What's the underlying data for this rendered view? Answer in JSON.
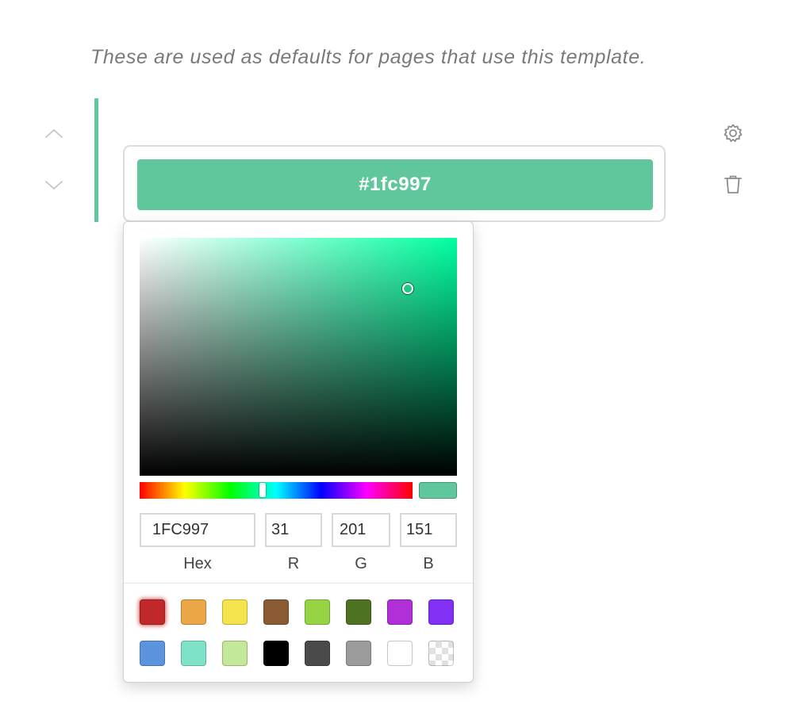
{
  "description_text": "These are used as defaults for pages that use this template.",
  "colors": {
    "accent": "#5fc79b",
    "selected_color": "#1fc997",
    "hue_color": "#00ffa0"
  },
  "color_field": {
    "value_label": "#1fc997"
  },
  "picker": {
    "saturation": 0.845,
    "brightness": 0.788,
    "hue_degrees": 162,
    "fields": {
      "hex": {
        "value": "1FC997",
        "label": "Hex"
      },
      "r": {
        "value": "31",
        "label": "R"
      },
      "g": {
        "value": "201",
        "label": "G"
      },
      "b": {
        "value": "151",
        "label": "B"
      }
    },
    "presets": [
      {
        "name": "red",
        "color": "#c0282a",
        "selected": true
      },
      {
        "name": "orange",
        "color": "#eba646"
      },
      {
        "name": "yellow",
        "color": "#f5e34d"
      },
      {
        "name": "brown",
        "color": "#8a5a33"
      },
      {
        "name": "lime",
        "color": "#97d444"
      },
      {
        "name": "dark-green",
        "color": "#4c7222"
      },
      {
        "name": "purple",
        "color": "#b02fd6"
      },
      {
        "name": "violet",
        "color": "#8230f3"
      },
      {
        "name": "blue",
        "color": "#5c93dd"
      },
      {
        "name": "aqua",
        "color": "#7ee2c8"
      },
      {
        "name": "light-green",
        "color": "#c4e899"
      },
      {
        "name": "black",
        "color": "#000000"
      },
      {
        "name": "dark-gray",
        "color": "#4a4a4a"
      },
      {
        "name": "gray",
        "color": "#9b9b9b"
      },
      {
        "name": "white",
        "color": "#ffffff"
      },
      {
        "name": "transparent",
        "color": "transparent"
      }
    ]
  },
  "icons": {
    "move_up": "chevron-up-icon",
    "move_down": "chevron-down-icon",
    "settings": "gear-icon",
    "delete": "trash-icon"
  }
}
